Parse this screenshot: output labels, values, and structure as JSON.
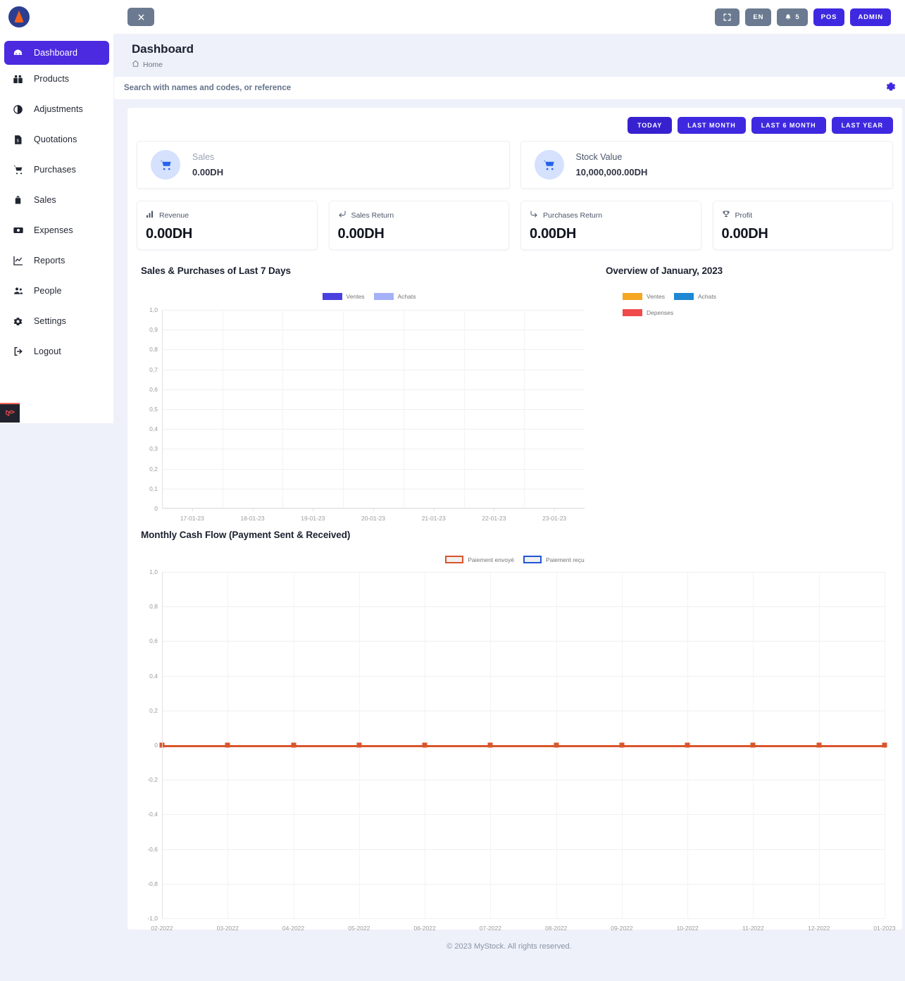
{
  "app": {
    "logo_name": "mystock-flame-logo"
  },
  "sidebar": {
    "items": [
      {
        "label": "Dashboard",
        "icon": "dashboard-icon",
        "name": "dashboard",
        "active": true
      },
      {
        "label": "Products",
        "icon": "products-icon",
        "name": "products",
        "active": false
      },
      {
        "label": "Adjustments",
        "icon": "adjustments-icon",
        "name": "adjustments",
        "active": false
      },
      {
        "label": "Quotations",
        "icon": "quotations-icon",
        "name": "quotations",
        "active": false
      },
      {
        "label": "Purchases",
        "icon": "purchases-icon",
        "name": "purchases",
        "active": false
      },
      {
        "label": "Sales",
        "icon": "sales-icon",
        "name": "sales",
        "active": false
      },
      {
        "label": "Expenses",
        "icon": "expenses-icon",
        "name": "expenses",
        "active": false
      },
      {
        "label": "Reports",
        "icon": "reports-icon",
        "name": "reports",
        "active": false
      },
      {
        "label": "People",
        "icon": "people-icon",
        "name": "people",
        "active": false
      },
      {
        "label": "Settings",
        "icon": "settings-icon",
        "name": "settings",
        "active": false
      },
      {
        "label": "Logout",
        "icon": "logout-icon",
        "name": "logout",
        "active": false
      }
    ],
    "debugbar_icon": "laravel-debugbar-icon"
  },
  "topbar": {
    "toggle_icon": "close-sidebar-icon",
    "fullscreen_icon": "fullscreen-icon",
    "language_label": "EN",
    "notification_icon": "bell-icon",
    "notification_count": "5",
    "pos_label": "POS",
    "admin_label": "ADMIN"
  },
  "header": {
    "title": "Dashboard",
    "breadcrumb_icon": "home-icon",
    "breadcrumb": "Home"
  },
  "search": {
    "placeholder": "Search with names and codes, or reference",
    "value": "",
    "settings_icon": "gear-icon"
  },
  "filters": [
    {
      "label": "TODAY",
      "active": true
    },
    {
      "label": "LAST MONTH",
      "active": false
    },
    {
      "label": "LAST 6 MONTH",
      "active": false
    },
    {
      "label": "LAST YEAR",
      "active": false
    }
  ],
  "top_cards": [
    {
      "label": "Sales",
      "value": "0.00DH",
      "icon": "cart-icon",
      "name": "sales-card"
    },
    {
      "label": "Stock Value",
      "value": "10,000,000.00DH",
      "icon": "cart-icon",
      "name": "stock-value-card"
    }
  ],
  "small_cards": [
    {
      "label": "Revenue",
      "value": "0.00DH",
      "icon": "bar-chart-icon",
      "name": "revenue-card"
    },
    {
      "label": "Sales Return",
      "value": "0.00DH",
      "icon": "return-arrow-icon",
      "name": "sales-return-card"
    },
    {
      "label": "Purchases Return",
      "value": "0.00DH",
      "icon": "forward-arrow-icon",
      "name": "purchases-return-card"
    },
    {
      "label": "Profit",
      "value": "0.00DH",
      "icon": "trophy-icon",
      "name": "profit-card"
    }
  ],
  "colors": {
    "primary": "#3f29e0",
    "primary_active": "#3721cf",
    "sidebar_active": "#4b2ae0",
    "grey_button": "#6b7a90",
    "card_icon_bg": "#d5e1fd",
    "card_icon_fg": "#2563eb",
    "ventes_bar": "#4b40e0",
    "achats_bar": "#a6b0f9",
    "ventes_donut": "#f5a623",
    "achats_donut": "#1e88d3",
    "depenses_donut": "#f04a4a",
    "payment_sent": "#d9552b",
    "payment_received": "#2255d6"
  },
  "chart_data": [
    {
      "type": "bar",
      "name": "sales-purchases-chart",
      "title": "Sales & Purchases of Last 7 Days",
      "categories": [
        "17-01-23",
        "18-01-23",
        "19-01-23",
        "20-01-23",
        "21-01-23",
        "22-01-23",
        "23-01-23"
      ],
      "series": [
        {
          "name": "Ventes",
          "color": "#4b40e0",
          "values": [
            0,
            0,
            0,
            0,
            0,
            0,
            0
          ]
        },
        {
          "name": "Achats",
          "color": "#a6b0f9",
          "values": [
            0,
            0,
            0,
            0,
            0,
            0,
            0
          ]
        }
      ],
      "ytick_labels": [
        "1,0",
        "0,9",
        "0,8",
        "0,7",
        "0,6",
        "0,5",
        "0,4",
        "0,3",
        "0,2",
        "0,1",
        "0"
      ],
      "ylim": [
        0,
        1
      ],
      "xlabel": "",
      "ylabel": "",
      "grid": true,
      "legend_position": "top-center"
    },
    {
      "type": "pie",
      "name": "overview-donut-chart",
      "title": "Overview of January, 2023",
      "categories": [
        "Ventes",
        "Achats",
        "Depenses"
      ],
      "values": [
        0,
        0,
        0
      ],
      "colors": [
        "#f5a623",
        "#1e88d3",
        "#f04a4a"
      ],
      "legend_position": "top-center",
      "empty": true
    },
    {
      "type": "line",
      "name": "monthly-cash-flow-chart",
      "title": "Monthly Cash Flow (Payment Sent & Received)",
      "categories": [
        "02-2022",
        "03-2022",
        "04-2022",
        "05-2022",
        "06-2022",
        "07-2022",
        "08-2022",
        "09-2022",
        "10-2022",
        "11-2022",
        "12-2022",
        "01-2023"
      ],
      "series": [
        {
          "name": "Paiement envoyé",
          "color": "#d9552b",
          "values": [
            0,
            0,
            0,
            0,
            0,
            0,
            0,
            0,
            0,
            0,
            0,
            0
          ]
        },
        {
          "name": "Paiement reçu",
          "color": "#2255d6",
          "values": [
            0,
            0,
            0,
            0,
            0,
            0,
            0,
            0,
            0,
            0,
            0,
            0
          ]
        }
      ],
      "ytick_labels": [
        "1,0",
        "0,8",
        "0,6",
        "0,4",
        "0,2",
        "0",
        "-0,2",
        "-0,4",
        "-0,6",
        "-0,8",
        "-1,0"
      ],
      "ylim": [
        -1,
        1
      ],
      "xlabel": "",
      "ylabel": "",
      "grid": true,
      "legend_position": "top-right"
    }
  ],
  "footer": {
    "text": "© 2023 MyStock. All rights reserved."
  }
}
